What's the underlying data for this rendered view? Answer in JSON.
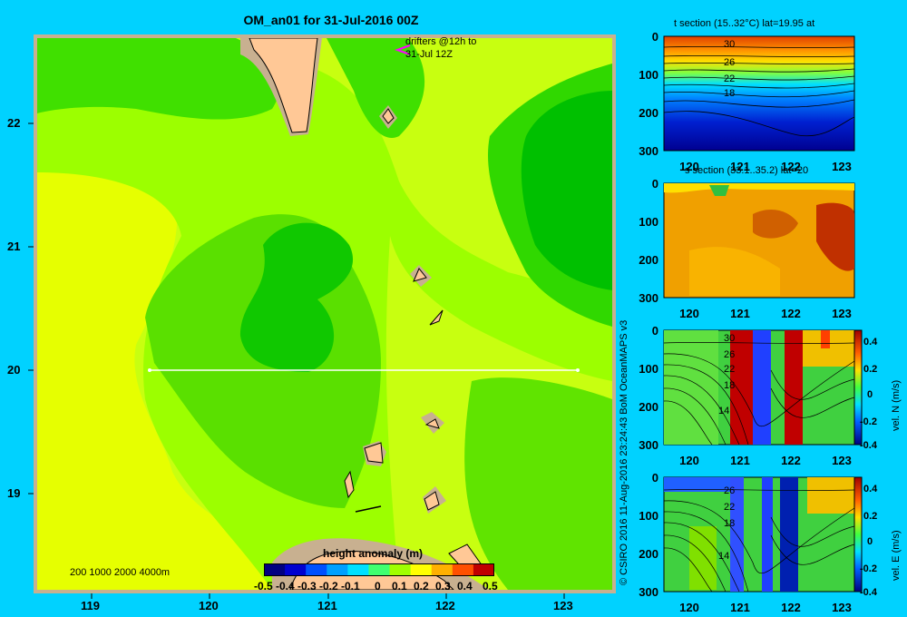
{
  "map": {
    "title": "OM_an01 for 31-Jul-2016 00Z",
    "drifter_note_line1": "drifters @12h to",
    "drifter_note_line2": "31-Jul 12Z",
    "depth_legend": "200  1000  2000  4000m",
    "x_ticks": [
      "119",
      "120",
      "121",
      "122",
      "123"
    ],
    "y_ticks": [
      "22",
      "21",
      "20",
      "19"
    ],
    "section_line": {
      "lat": 20.0,
      "lon_start": 119.5,
      "lon_end": 123.2
    }
  },
  "colorbar": {
    "title": "height anomaly  (m)",
    "tick_labels": [
      "-0.5",
      "-0.4",
      "-0.3",
      "-0.2",
      "-0.1",
      "0",
      "0.1",
      "0.2",
      "0.3",
      "0.4",
      "0.5"
    ],
    "colors": [
      "#000080",
      "#0000d0",
      "#0050ff",
      "#00a0ff",
      "#00e0ff",
      "#40ff70",
      "#a0ff00",
      "#ffff00",
      "#ffb000",
      "#ff5000",
      "#c00000"
    ]
  },
  "credit": "© CSIRO 2016   11-Aug-2016 23:24:43 BoM OceanMAPS v3",
  "panels": {
    "t_section": {
      "title": "t section (15..32°C) lat=19.95 at",
      "contour_labels": [
        "30",
        "26",
        "22",
        "18"
      ]
    },
    "s_section": {
      "title": "s section (33.1..35.2) lat=20"
    },
    "vel_n": {
      "label": "vel. N (m/s)",
      "contour_labels": [
        "30",
        "26",
        "22",
        "18",
        "14"
      ]
    },
    "vel_e": {
      "label": "vel. E (m/s)",
      "contour_labels": [
        "26",
        "22",
        "18",
        "14"
      ]
    },
    "depth_ticks": [
      "0",
      "100",
      "200",
      "300"
    ],
    "lon_ticks": [
      "120",
      "121",
      "122",
      "123"
    ],
    "vel_cbar_ticks": [
      "0.4",
      "0.2",
      "0",
      "-0.2",
      "-0.4"
    ]
  },
  "chart_data": [
    {
      "type": "heatmap",
      "title": "OM_an01 for 31-Jul-2016 00Z",
      "xlabel": "",
      "ylabel": "",
      "xlim": [
        118.5,
        123.5
      ],
      "ylim": [
        18.25,
        22.7
      ],
      "colorbar": "height anomaly  (m)",
      "crange": [
        -0.5,
        0.5
      ]
    },
    {
      "type": "heatmap",
      "title": "t section (15..32°C) lat=19.95 at",
      "xlim": [
        119.5,
        123.2
      ],
      "ylim": [
        300,
        0
      ]
    },
    {
      "type": "heatmap",
      "title": "s section (33.1..35.2) lat=20",
      "xlim": [
        119.5,
        123.2
      ],
      "ylim": [
        300,
        0
      ]
    },
    {
      "type": "heatmap",
      "title": "",
      "ylabel": "vel. N (m/s)",
      "xlim": [
        119.5,
        123.2
      ],
      "ylim": [
        300,
        0
      ],
      "crange": [
        -0.4,
        0.4
      ]
    },
    {
      "type": "heatmap",
      "title": "",
      "ylabel": "vel. E (m/s)",
      "xlim": [
        119.5,
        123.2
      ],
      "ylim": [
        300,
        0
      ],
      "crange": [
        -0.4,
        0.4
      ]
    }
  ]
}
